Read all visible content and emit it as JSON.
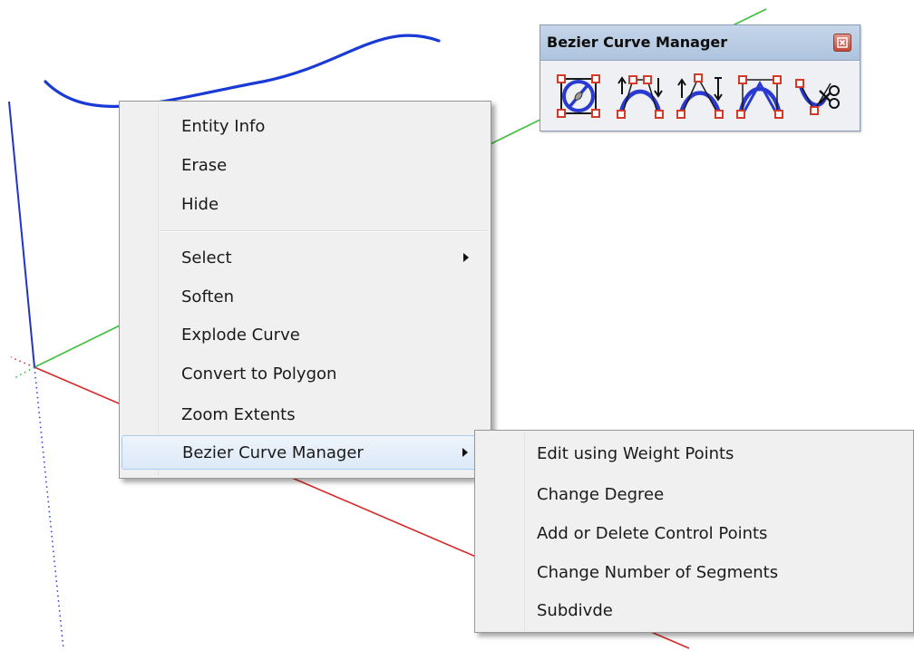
{
  "toolbar": {
    "title": "Bezier Curve Manager",
    "close_icon": "close-icon",
    "buttons": [
      {
        "icon": "draw-bezier-curve-icon"
      },
      {
        "icon": "edit-weight-points-icon"
      },
      {
        "icon": "change-degree-icon"
      },
      {
        "icon": "add-delete-control-points-icon"
      },
      {
        "icon": "cut-curve-icon"
      }
    ]
  },
  "context_menu": {
    "items": [
      {
        "label": "Entity Info"
      },
      {
        "label": "Erase"
      },
      {
        "label": "Hide"
      },
      {
        "label": "Select",
        "has_submenu": true
      },
      {
        "label": "Soften"
      },
      {
        "label": "Explode Curve"
      },
      {
        "label": "Convert to Polygon"
      },
      {
        "label": "Zoom Extents"
      },
      {
        "label": "Bezier Curve Manager",
        "has_submenu": true,
        "highlighted": true
      }
    ]
  },
  "submenu": {
    "items": [
      {
        "label": "Edit using Weight Points"
      },
      {
        "label": "Change Degree"
      },
      {
        "label": "Add or Delete Control Points"
      },
      {
        "label": "Change Number of Segments"
      },
      {
        "label": "Subdivde"
      }
    ]
  },
  "colors": {
    "curve": "#1a3ad6",
    "axis_red": "#d42a2a",
    "axis_green": "#3cbf3c",
    "axis_blue": "#2233cc",
    "menu_bg": "#f0f0f0",
    "toolbar_title_bg": "#b9cce4"
  }
}
